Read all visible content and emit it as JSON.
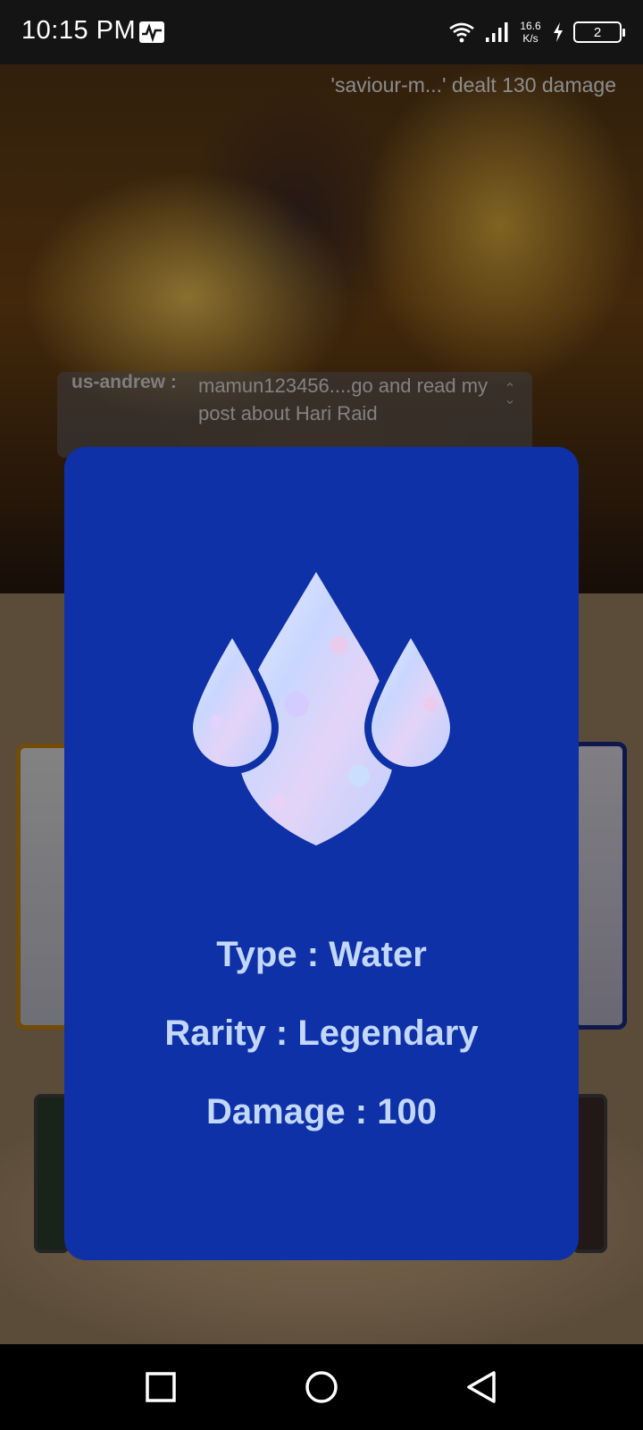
{
  "status_bar": {
    "time": "10:15 PM",
    "net_speed_value": "16.6",
    "net_speed_unit": "K/s",
    "battery": "2",
    "icons": [
      "activity-icon",
      "wifi-icon",
      "signal-icon",
      "charging-icon",
      "battery-icon"
    ]
  },
  "scene": {
    "damage_log": "'saviour-m...' dealt 130 damage",
    "chat": {
      "user": "us-andrew :",
      "message": "mamun123456....go and read my post about Hari Raid"
    }
  },
  "modal": {
    "icon": "water-drops-icon",
    "type_line": "Type : Water",
    "rarity_line": "Rarity : Legendary",
    "damage_line": "Damage : 100",
    "colors": {
      "background": "#0e31a8",
      "text": "#c2d7fb"
    }
  },
  "nav_bar": {
    "buttons": [
      "recent-apps-button",
      "home-button",
      "back-button"
    ]
  }
}
